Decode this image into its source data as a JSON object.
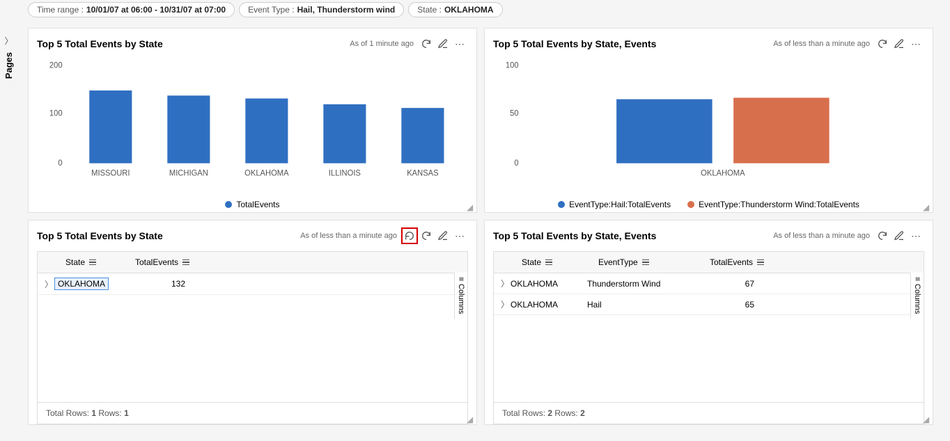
{
  "filters": {
    "timeRange": {
      "label": "Time range :",
      "value": "10/01/07 at 06:00 - 10/31/07 at 07:00"
    },
    "eventType": {
      "label": "Event Type :",
      "value": "Hail, Thunderstorm wind"
    },
    "state": {
      "label": "State :",
      "value": "OKLAHOMA"
    }
  },
  "pagesLabel": "Pages",
  "tile1": {
    "title": "Top 5 Total Events by State",
    "status": "As of 1 minute ago",
    "legend": "TotalEvents"
  },
  "tile2": {
    "title": "Top 5 Total Events by State, Events",
    "status": "As of less than a minute ago",
    "legendA": "EventType:Hail:TotalEvents",
    "legendB": "EventType:Thunderstorm Wind:TotalEvents"
  },
  "tile3": {
    "title": "Top 5 Total Events by State",
    "status": "As of less than a minute ago",
    "colState": "State",
    "colTotal": "TotalEvents",
    "colToggle": "Columns",
    "rows": [
      {
        "state": "OKLAHOMA",
        "total": "132"
      }
    ],
    "footer": "Total Rows: 1  Rows: 1",
    "footer_prefix": "Total Rows: ",
    "footer_totalRows": "1",
    "footer_sep": "  Rows: ",
    "footer_rows": "1"
  },
  "tile4": {
    "title": "Top 5 Total Events by State, Events",
    "status": "As of less than a minute ago",
    "colState": "State",
    "colEventType": "EventType",
    "colTotal": "TotalEvents",
    "colToggle": "Columns",
    "rows": [
      {
        "state": "OKLAHOMA",
        "eventType": "Thunderstorm Wind",
        "total": "67"
      },
      {
        "state": "OKLAHOMA",
        "eventType": "Hail",
        "total": "65"
      }
    ],
    "footer_prefix": "Total Rows: ",
    "footer_totalRows": "2",
    "footer_sep": "  Rows: ",
    "footer_rows": "2"
  },
  "chart_data": [
    {
      "type": "bar",
      "title": "Top 5 Total Events by State",
      "categories": [
        "MISSOURI",
        "MICHIGAN",
        "OKLAHOMA",
        "ILLINOIS",
        "KANSAS"
      ],
      "values": [
        148,
        138,
        132,
        120,
        113
      ],
      "ylabel": "",
      "ylim": [
        0,
        200
      ],
      "yticks": [
        0,
        100,
        200
      ],
      "series_name": "TotalEvents",
      "colors": [
        "#2f6fc1"
      ]
    },
    {
      "type": "bar",
      "title": "Top 5 Total Events by State, Events",
      "categories": [
        "OKLAHOMA"
      ],
      "series": [
        {
          "name": "EventType:Hail:TotalEvents",
          "values": [
            65
          ],
          "color": "#2f6fc1"
        },
        {
          "name": "EventType:Thunderstorm Wind:TotalEvents",
          "values": [
            67
          ],
          "color": "#d86f4c"
        }
      ],
      "ylim": [
        0,
        100
      ],
      "yticks": [
        0,
        50,
        100
      ]
    }
  ]
}
